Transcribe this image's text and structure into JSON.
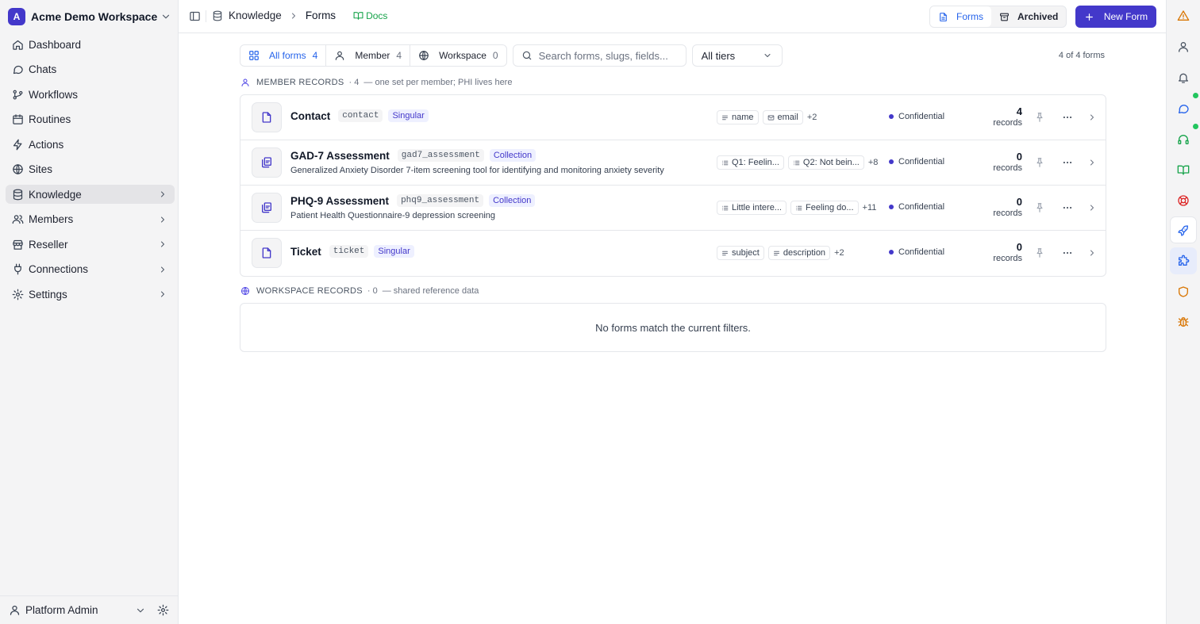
{
  "workspace": {
    "initial": "A",
    "name": "Acme Demo Workspace"
  },
  "sidebar": {
    "items": [
      {
        "label": "Dashboard",
        "icon": "home-icon"
      },
      {
        "label": "Chats",
        "icon": "chat-icon"
      },
      {
        "label": "Workflows",
        "icon": "workflow-icon"
      },
      {
        "label": "Routines",
        "icon": "calendar-icon"
      },
      {
        "label": "Actions",
        "icon": "bolt-icon"
      },
      {
        "label": "Sites",
        "icon": "globe-icon"
      },
      {
        "label": "Knowledge",
        "icon": "database-icon",
        "active": true,
        "expandable": true
      },
      {
        "label": "Members",
        "icon": "users-icon",
        "expandable": true
      },
      {
        "label": "Reseller",
        "icon": "store-icon",
        "expandable": true
      },
      {
        "label": "Connections",
        "icon": "plug-icon",
        "expandable": true
      },
      {
        "label": "Settings",
        "icon": "gear-icon",
        "expandable": true
      }
    ],
    "footer": {
      "user": "Platform Admin"
    }
  },
  "topbar": {
    "breadcrumb": [
      "Knowledge",
      "Forms"
    ],
    "docs_label": "Docs",
    "view_tabs": [
      {
        "label": "Forms",
        "active": true
      },
      {
        "label": "Archived",
        "active": false
      }
    ],
    "new_button": "New Form"
  },
  "filters": {
    "tabs": [
      {
        "label": "All forms",
        "count": "4",
        "active": true
      },
      {
        "label": "Member",
        "count": "4"
      },
      {
        "label": "Workspace",
        "count": "0"
      }
    ],
    "search_placeholder": "Search forms, slugs, fields...",
    "tier_selected": "All tiers",
    "summary": "4 of 4 forms"
  },
  "member_section": {
    "title": "MEMBER RECORDS",
    "count": "· 4",
    "description": "— one set per member; PHI lives here"
  },
  "forms": [
    {
      "name": "Contact",
      "slug": "contact",
      "type": "Singular",
      "description": "",
      "fields": [
        {
          "label": "name",
          "icon": "text-icon"
        },
        {
          "label": "email",
          "icon": "mail-icon"
        }
      ],
      "more_fields": "+2",
      "tier": "Confidential",
      "records": "4",
      "records_label": "records"
    },
    {
      "name": "GAD-7 Assessment",
      "slug": "gad7_assessment",
      "type": "Collection",
      "description": "Generalized Anxiety Disorder 7-item screening tool for identifying and monitoring anxiety severity",
      "fields": [
        {
          "label": "Q1: Feelin...",
          "icon": "list-icon"
        },
        {
          "label": "Q2: Not bein...",
          "icon": "list-icon"
        }
      ],
      "more_fields": "+8",
      "tier": "Confidential",
      "records": "0",
      "records_label": "records"
    },
    {
      "name": "PHQ-9 Assessment",
      "slug": "phq9_assessment",
      "type": "Collection",
      "description": "Patient Health Questionnaire-9 depression screening",
      "fields": [
        {
          "label": "Little intere...",
          "icon": "list-icon"
        },
        {
          "label": "Feeling do...",
          "icon": "list-icon"
        }
      ],
      "more_fields": "+11",
      "tier": "Confidential",
      "records": "0",
      "records_label": "records"
    },
    {
      "name": "Ticket",
      "slug": "ticket",
      "type": "Singular",
      "description": "",
      "fields": [
        {
          "label": "subject",
          "icon": "text-icon"
        },
        {
          "label": "description",
          "icon": "text-icon"
        }
      ],
      "more_fields": "+2",
      "tier": "Confidential",
      "records": "0",
      "records_label": "records"
    }
  ],
  "workspace_section": {
    "title": "WORKSPACE RECORDS",
    "count": "· 0",
    "description": "— shared reference data",
    "empty_message": "No forms match the current filters."
  },
  "colors": {
    "accent": "#4338ca",
    "link": "#2563eb",
    "docs": "#16a34a",
    "status_online": "#22c55e"
  }
}
